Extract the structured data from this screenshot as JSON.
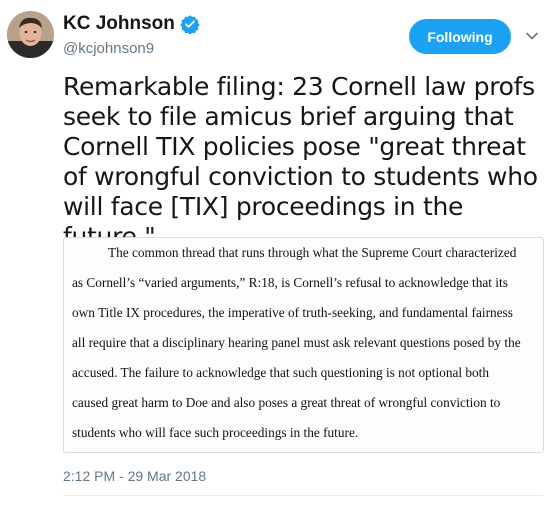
{
  "user": {
    "display_name": "KC Johnson",
    "handle": "@kcjohnson9",
    "verified": true
  },
  "actions": {
    "follow_label": "Following",
    "menu_icon": "chevron-down-icon"
  },
  "tweet": {
    "text": "Remarkable filing: 23 Cornell law profs seek to file amicus brief arguing that Cornell TIX policies pose \"great threat of wrongful conviction to students who will face [TIX] proceedings in the future.\"",
    "timestamp": "2:12 PM - 29 Mar 2018"
  },
  "media": {
    "lines": [
      "The common thread that runs through what the Supreme Court characterized",
      "as Cornell’s “varied arguments,” R:18, is Cornell’s refusal to acknowledge that its",
      "own Title IX procedures, the imperative of truth-seeking, and fundamental fairness",
      "all require that a disciplinary hearing panel must ask relevant questions posed by the",
      "accused.  The failure to acknowledge that such questioning is not optional both",
      "caused great harm to Doe and also poses a great threat of wrongful conviction to",
      "students who will face such proceedings in the future."
    ]
  },
  "colors": {
    "accent": "#1da1f2",
    "secondary_text": "#657786",
    "divider": "#e6ecf0"
  }
}
